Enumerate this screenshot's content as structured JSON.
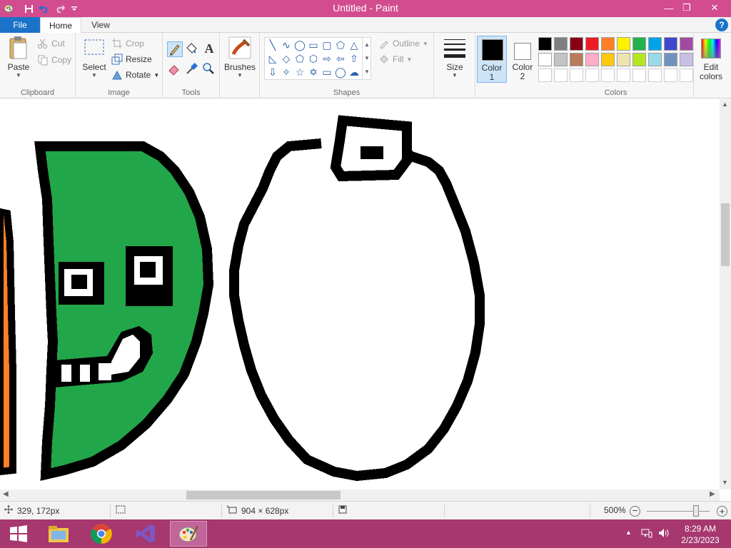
{
  "window": {
    "title": "Untitled - Paint",
    "controls": {
      "minimize": "—",
      "restore": "❐",
      "close": "✕"
    }
  },
  "quick_access": {
    "icons": [
      "paint-app-icon",
      "save-icon",
      "undo-icon",
      "redo-icon",
      "customize-icon"
    ]
  },
  "tabs": [
    {
      "label": "File"
    },
    {
      "label": "Home"
    },
    {
      "label": "View"
    }
  ],
  "help_label": "?",
  "ribbon": {
    "clipboard": {
      "paste": "Paste",
      "cut": "Cut",
      "copy": "Copy",
      "group": "Clipboard"
    },
    "image": {
      "select": "Select",
      "crop": "Crop",
      "resize": "Resize",
      "rotate": "Rotate",
      "group": "Image"
    },
    "tools": {
      "group": "Tools",
      "icons": [
        "pencil-icon",
        "fill-icon",
        "text-icon",
        "eraser-icon",
        "color-picker-icon",
        "magnifier-icon"
      ],
      "text_glyph": "A"
    },
    "brushes": {
      "label": "Brushes"
    },
    "shapes": {
      "outline": "Outline",
      "fill": "Fill",
      "group": "Shapes"
    },
    "size": {
      "label": "Size"
    },
    "color1": {
      "label_a": "Color",
      "label_b": "1",
      "value": "#000000"
    },
    "color2": {
      "label_a": "Color",
      "label_b": "2",
      "value": "#ffffff"
    },
    "colors": {
      "group": "Colors",
      "row1": [
        "#000000",
        "#7f7f7f",
        "#880015",
        "#ed1c24",
        "#ff7f27",
        "#fff200",
        "#22b14c",
        "#00a2e8",
        "#3f48cc",
        "#a349a4"
      ],
      "row2": [
        "#ffffff",
        "#c3c3c3",
        "#b97a57",
        "#ffaec9",
        "#ffc90e",
        "#efe4b0",
        "#b5e61d",
        "#99d9ea",
        "#7092be",
        "#c8bfe7"
      ]
    },
    "edit_colors": {
      "label_a": "Edit",
      "label_b": "colors"
    }
  },
  "canvas": {
    "drawing_colors": {
      "outline": "#000000",
      "green": "#22a64a",
      "orange": "#ff7f27",
      "white": "#ffffff"
    }
  },
  "status": {
    "cursor_pos": "329, 172px",
    "selection_size": "",
    "canvas_size": "904 × 628px",
    "zoom": "500%",
    "zoom_slider_value": 0.78
  },
  "taskbar": {
    "apps": [
      "windows-start",
      "file-explorer",
      "chrome",
      "visual-studio",
      "paint"
    ],
    "time": "8:29 AM",
    "date": "2/23/2023"
  }
}
